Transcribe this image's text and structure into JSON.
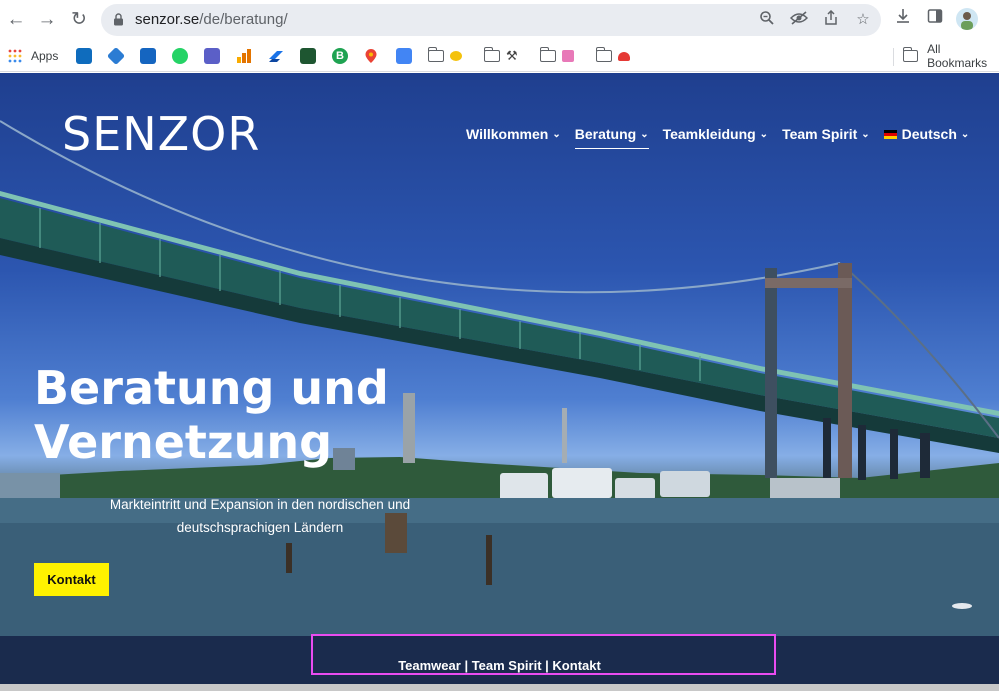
{
  "browser": {
    "url_domain": "senzor.se",
    "url_path": "/de/beratung/",
    "bookmarks": {
      "apps_label": "Apps",
      "all_bookmarks_label": "All Bookmarks"
    }
  },
  "site": {
    "logo": "SENZOR",
    "nav": [
      {
        "label": "Willkommen"
      },
      {
        "label": "Beratung"
      },
      {
        "label": "Teamkleidung"
      },
      {
        "label": "Team Spirit"
      },
      {
        "label": "Deutsch"
      }
    ],
    "hero": {
      "headline_line1": "Beratung und",
      "headline_line2": "Vernetzung",
      "subline_line1": "Markteintritt und Expansion in den nordischen und",
      "subline_line2": "deutschsprachigen Ländern",
      "cta": "Kontakt"
    },
    "footer_links": [
      "Teamwear",
      "Team Spirit",
      "Kontakt"
    ],
    "footer_separator": " | "
  },
  "colors": {
    "cta_background": "#fff200",
    "footer_strip": "#1a2b4d",
    "highlight_border": "#e94cf0"
  },
  "icons": [
    "back-icon",
    "forward-icon",
    "reload-icon",
    "lock-icon",
    "zoom-icon",
    "eye-off-icon",
    "share-icon",
    "star-icon",
    "download-icon",
    "sidebar-icon",
    "profile-avatar"
  ]
}
